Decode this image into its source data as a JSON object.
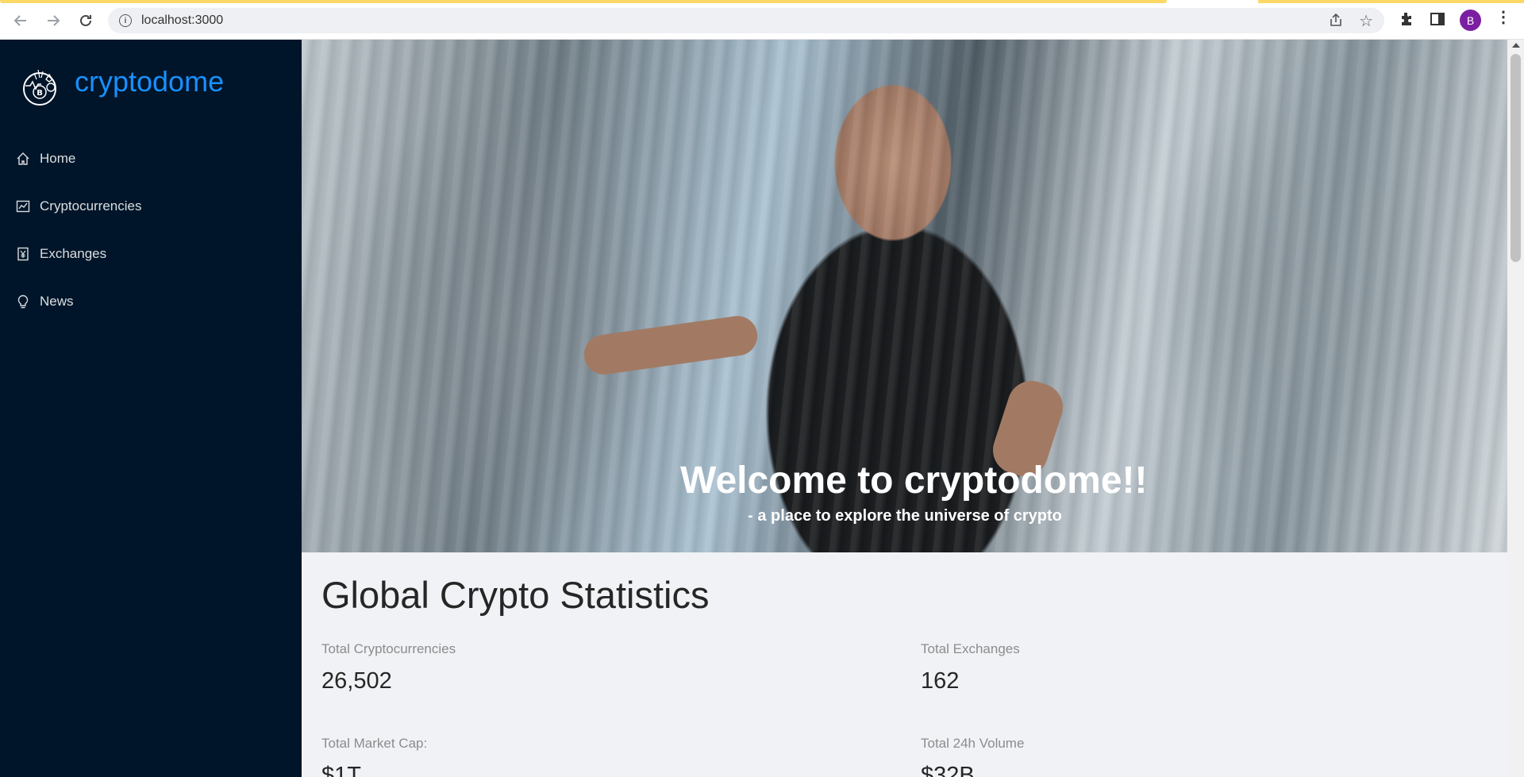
{
  "browser": {
    "url": "localhost:3000",
    "profile_initial": "B"
  },
  "sidebar": {
    "brand": "cryptodome",
    "items": [
      {
        "label": "Home",
        "icon": "home-icon"
      },
      {
        "label": "Cryptocurrencies",
        "icon": "fund-icon"
      },
      {
        "label": "Exchanges",
        "icon": "money-collect-icon"
      },
      {
        "label": "News",
        "icon": "bulb-icon"
      }
    ]
  },
  "hero": {
    "title": "Welcome to cryptodome!!",
    "subtitle": "- a place to explore the universe of crypto"
  },
  "stats": {
    "title": "Global Crypto Statistics",
    "items": [
      {
        "label": "Total Cryptocurrencies",
        "value": "26,502"
      },
      {
        "label": "Total Exchanges",
        "value": "162"
      },
      {
        "label": "Total Market Cap:",
        "value": "$1T"
      },
      {
        "label": "Total 24h Volume",
        "value": "$32B"
      }
    ]
  },
  "colors": {
    "sidebar_bg": "#001529",
    "brand": "#1890ff",
    "content_bg": "#f0f2f5"
  }
}
